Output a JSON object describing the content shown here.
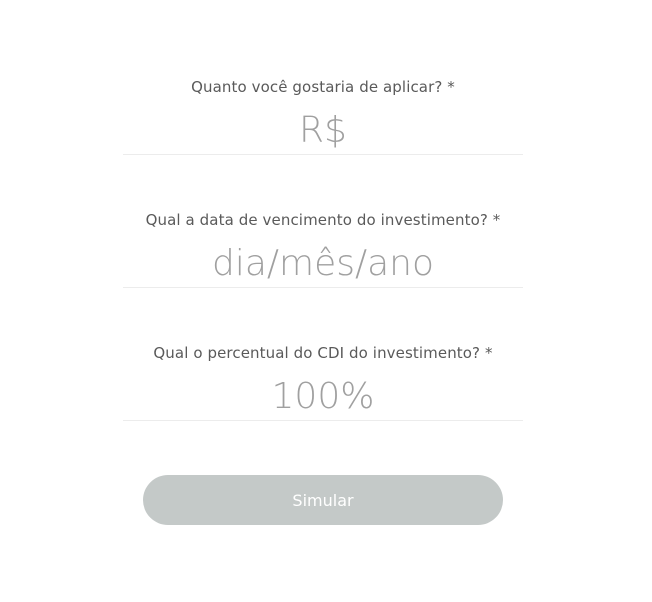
{
  "form": {
    "amount": {
      "label": "Quanto você gostaria de aplicar? *",
      "placeholder": "R$",
      "value": ""
    },
    "maturity_date": {
      "label": "Qual a data de vencimento do investimento? *",
      "placeholder": "dia/mês/ano",
      "value": ""
    },
    "cdi_percent": {
      "label": "Qual o percentual do CDI do investimento? *",
      "placeholder": "100%",
      "value": ""
    },
    "submit_label": "Simular"
  },
  "colors": {
    "label_text": "#5a5a5a",
    "placeholder_text": "#a0a0a0",
    "underline": "#ececec",
    "button_bg": "#c4c9c8",
    "button_text": "#ffffff"
  }
}
